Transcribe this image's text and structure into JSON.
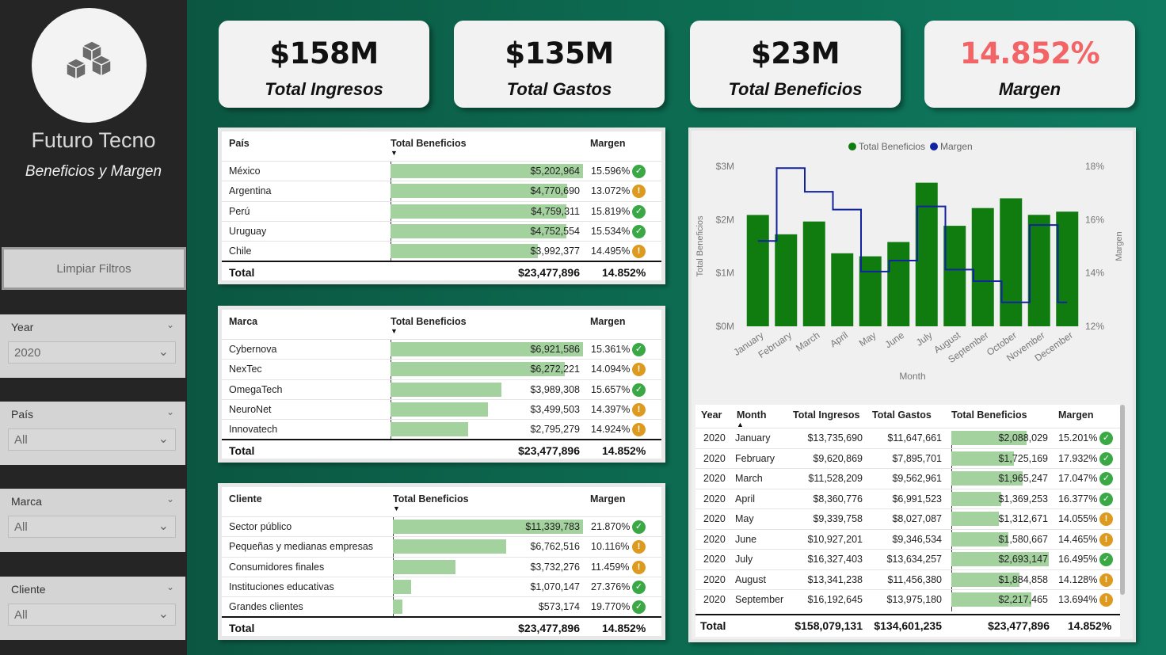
{
  "sidebar": {
    "title": "Futuro Tecno",
    "subtitle": "Beneficios y Margen",
    "clear_button": "Limpiar Filtros",
    "slicers": [
      {
        "label": "Year",
        "value": "2020"
      },
      {
        "label": "País",
        "value": "All"
      },
      {
        "label": "Marca",
        "value": "All"
      },
      {
        "label": "Cliente",
        "value": "All"
      }
    ]
  },
  "kpis": [
    {
      "value": "$158M",
      "label": "Total Ingresos"
    },
    {
      "value": "$135M",
      "label": "Total Gastos"
    },
    {
      "value": "$23M",
      "label": "Total Beneficios"
    },
    {
      "value": "14.852%",
      "label": "Margen",
      "color": "#f26466"
    }
  ],
  "tables": [
    {
      "col1": "País",
      "col2": "Total Beneficios",
      "col3": "Margen",
      "rows": [
        {
          "name": "México",
          "value": "$5,202,964",
          "amount": 5202964,
          "margin": "15.596%",
          "status": "ok"
        },
        {
          "name": "Argentina",
          "value": "$4,770,690",
          "amount": 4770690,
          "margin": "13.072%",
          "status": "warn"
        },
        {
          "name": "Perú",
          "value": "$4,759,311",
          "amount": 4759311,
          "margin": "15.819%",
          "status": "ok"
        },
        {
          "name": "Uruguay",
          "value": "$4,752,554",
          "amount": 4752554,
          "margin": "15.534%",
          "status": "ok"
        },
        {
          "name": "Chile",
          "value": "$3,992,377",
          "amount": 3992377,
          "margin": "14.495%",
          "status": "warn"
        }
      ],
      "total_label": "Total",
      "total_value": "$23,477,896",
      "total_margin": "14.852%"
    },
    {
      "col1": "Marca",
      "col2": "Total Beneficios",
      "col3": "Margen",
      "rows": [
        {
          "name": "Cybernova",
          "value": "$6,921,586",
          "amount": 6921586,
          "margin": "15.361%",
          "status": "ok"
        },
        {
          "name": "NexTec",
          "value": "$6,272,221",
          "amount": 6272221,
          "margin": "14.094%",
          "status": "warn"
        },
        {
          "name": "OmegaTech",
          "value": "$3,989,308",
          "amount": 3989308,
          "margin": "15.657%",
          "status": "ok"
        },
        {
          "name": "NeuroNet",
          "value": "$3,499,503",
          "amount": 3499503,
          "margin": "14.397%",
          "status": "warn"
        },
        {
          "name": "Innovatech",
          "value": "$2,795,279",
          "amount": 2795279,
          "margin": "14.924%",
          "status": "warn"
        }
      ],
      "total_label": "Total",
      "total_value": "$23,477,896",
      "total_margin": "14.852%"
    },
    {
      "col1": "Cliente",
      "col2": "Total Beneficios",
      "col3": "Margen",
      "rows": [
        {
          "name": "Sector público",
          "value": "$11,339,783",
          "amount": 11339783,
          "margin": "21.870%",
          "status": "ok"
        },
        {
          "name": "Pequeñas y medianas empresas",
          "value": "$6,762,516",
          "amount": 6762516,
          "margin": "10.116%",
          "status": "warn"
        },
        {
          "name": "Consumidores finales",
          "value": "$3,732,276",
          "amount": 3732276,
          "margin": "11.459%",
          "status": "warn"
        },
        {
          "name": "Instituciones educativas",
          "value": "$1,070,147",
          "amount": 1070147,
          "margin": "27.376%",
          "status": "ok"
        },
        {
          "name": "Grandes clientes",
          "value": "$573,174",
          "amount": 573174,
          "margin": "19.770%",
          "status": "ok"
        }
      ],
      "total_label": "Total",
      "total_value": "$23,477,896",
      "total_margin": "14.852%"
    }
  ],
  "chart_data": {
    "type": "bar",
    "legend": [
      "Total Beneficios",
      "Margen"
    ],
    "legend_position": "top-center",
    "colors": {
      "bars": "#107c10",
      "line": "#12239e"
    },
    "categories": [
      "January",
      "February",
      "March",
      "April",
      "May",
      "June",
      "July",
      "August",
      "September",
      "October",
      "November",
      "December"
    ],
    "series": [
      {
        "name": "Total Beneficios",
        "type": "bar",
        "axis": "left",
        "values": [
          2088029,
          1725169,
          1965247,
          1369253,
          1312671,
          1580667,
          2693147,
          1884858,
          2217465,
          2400000,
          2090000,
          2150000
        ]
      },
      {
        "name": "Margen",
        "type": "step-line",
        "axis": "right",
        "values": [
          15.201,
          17.932,
          17.047,
          16.377,
          14.055,
          14.465,
          16.495,
          14.128,
          13.694,
          12.9,
          15.8,
          12.9
        ]
      }
    ],
    "xlabel": "Month",
    "ylabel": "Total Beneficios",
    "ylabel_right": "Margen",
    "ylim": [
      0,
      3000000
    ],
    "ylim_right": [
      12,
      18
    ],
    "y_ticks": [
      "$0M",
      "$1M",
      "$2M",
      "$3M"
    ],
    "y_right_ticks": [
      "12%",
      "14%",
      "16%",
      "18%"
    ]
  },
  "monthly_table": {
    "headers": [
      "Year",
      "Month",
      "Total Ingresos",
      "Total Gastos",
      "Total Beneficios",
      "Margen"
    ],
    "rows": [
      {
        "year": "2020",
        "month": "January",
        "ingresos": "$13,735,690",
        "gastos": "$11,647,661",
        "beneficios": "$2,088,029",
        "amount": 2088029,
        "margin": "15.201%",
        "status": "ok"
      },
      {
        "year": "2020",
        "month": "February",
        "ingresos": "$9,620,869",
        "gastos": "$7,895,701",
        "beneficios": "$1,725,169",
        "amount": 1725169,
        "margin": "17.932%",
        "status": "ok"
      },
      {
        "year": "2020",
        "month": "March",
        "ingresos": "$11,528,209",
        "gastos": "$9,562,961",
        "beneficios": "$1,965,247",
        "amount": 1965247,
        "margin": "17.047%",
        "status": "ok"
      },
      {
        "year": "2020",
        "month": "April",
        "ingresos": "$8,360,776",
        "gastos": "$6,991,523",
        "beneficios": "$1,369,253",
        "amount": 1369253,
        "margin": "16.377%",
        "status": "ok"
      },
      {
        "year": "2020",
        "month": "May",
        "ingresos": "$9,339,758",
        "gastos": "$8,027,087",
        "beneficios": "$1,312,671",
        "amount": 1312671,
        "margin": "14.055%",
        "status": "warn"
      },
      {
        "year": "2020",
        "month": "June",
        "ingresos": "$10,927,201",
        "gastos": "$9,346,534",
        "beneficios": "$1,580,667",
        "amount": 1580667,
        "margin": "14.465%",
        "status": "warn"
      },
      {
        "year": "2020",
        "month": "July",
        "ingresos": "$16,327,403",
        "gastos": "$13,634,257",
        "beneficios": "$2,693,147",
        "amount": 2693147,
        "margin": "16.495%",
        "status": "ok"
      },
      {
        "year": "2020",
        "month": "August",
        "ingresos": "$13,341,238",
        "gastos": "$11,456,380",
        "beneficios": "$1,884,858",
        "amount": 1884858,
        "margin": "14.128%",
        "status": "warn"
      },
      {
        "year": "2020",
        "month": "September",
        "ingresos": "$16,192,645",
        "gastos": "$13,975,180",
        "beneficios": "$2,217,465",
        "amount": 2217465,
        "margin": "13.694%",
        "status": "warn"
      }
    ],
    "total": {
      "label": "Total",
      "ingresos": "$158,079,131",
      "gastos": "$134,601,235",
      "beneficios": "$23,477,896",
      "margin": "14.852%"
    }
  }
}
